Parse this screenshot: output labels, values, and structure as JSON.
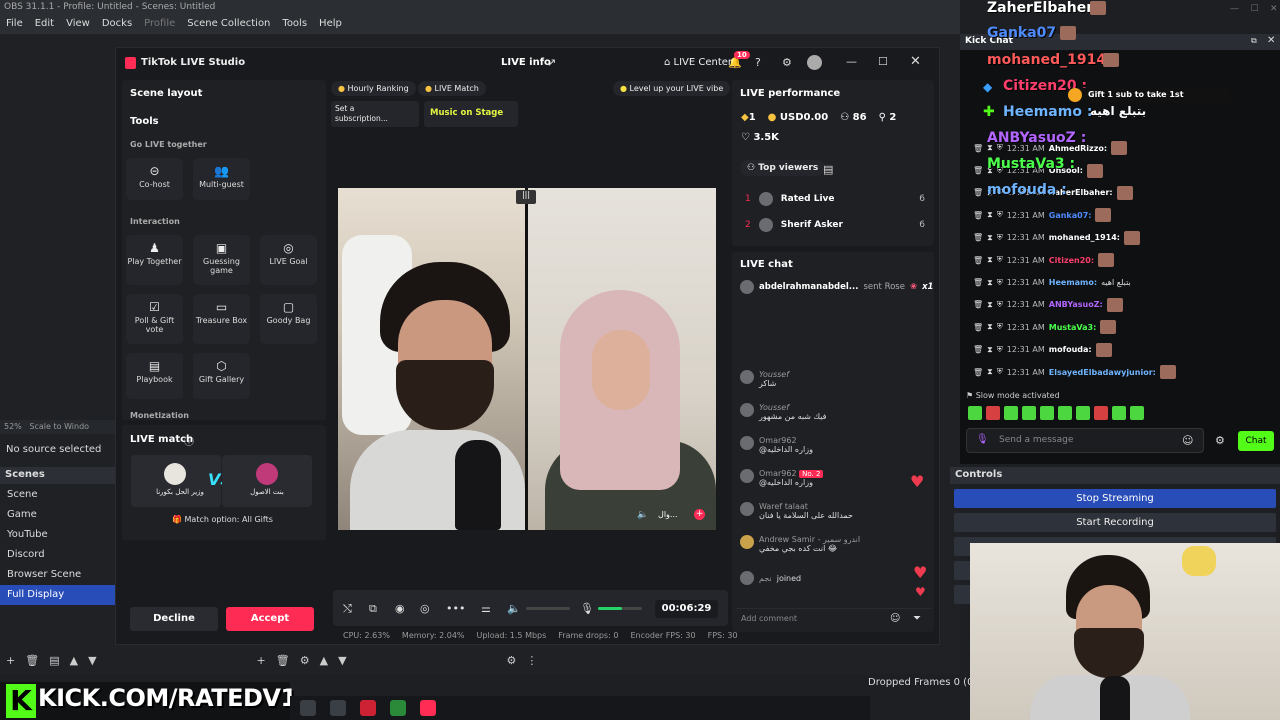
{
  "obs": {
    "title": "OBS 31.1.1 - Profile: Untitled - Scenes: Untitled",
    "menu": [
      "File",
      "Edit",
      "View",
      "Docks",
      "Profile",
      "Scene Collection",
      "Tools",
      "Help"
    ],
    "zoom": "52%",
    "scale_label": "Scale to Windo",
    "no_source": "No source selected",
    "scenes_title": "Scenes",
    "scenes": [
      "Scene",
      "Game",
      "YouTube",
      "Discord",
      "Browser Scene",
      "Full Display"
    ],
    "selected_scene": "Full Display",
    "dropped_frames": "Dropped Frames 0 (0.0%)",
    "kick_url": "KICK.COM/RATEDV1",
    "kick_k": "K"
  },
  "tiktok": {
    "app_name": "TikTok LIVE Studio",
    "live_info": "LIVE info",
    "live_center": "LIVE Center",
    "notif_count": "10",
    "scene_layout": "Scene layout",
    "tools": "Tools",
    "go_live_together": "Go LIVE together",
    "cohost": "Co-host",
    "multiguest": "Multi-guest",
    "interaction": "Interaction",
    "tool_items": [
      "Play Together",
      "Guessing game",
      "LIVE Goal",
      "Poll & Gift vote",
      "Treasure Box",
      "Goody Bag",
      "Playbook",
      "Gift Gallery"
    ],
    "monetization": "Monetization",
    "live_match": "LIVE match",
    "match_left": "وزير الحل بكورنا",
    "match_right": "بنت الاصول",
    "vs": "VS",
    "match_option": "Match option: All Gifts",
    "decline": "Decline",
    "accept": "Accept",
    "hourly_ranking": "Hourly Ranking",
    "live_match_pill": "LIVE Match",
    "level_up": "Level up your LIVE vibe",
    "set_sub": "Set a subscription...",
    "music_on_stage": "Music on Stage",
    "video_label": "وال...",
    "timer": "00:06:29",
    "stats": [
      "CPU: 2.63%",
      "Memory: 2.04%",
      "Upload: 1.5 Mbps",
      "Frame drops: 0",
      "Encoder FPS: 30",
      "FPS: 30"
    ],
    "live_performance": "LIVE performance",
    "perf_diamonds": "1",
    "perf_usd": "USD0.00",
    "perf_viewers": "86",
    "perf_new": "2",
    "perf_likes": "3.5K",
    "top_viewers": "Top viewers",
    "viewers": [
      {
        "rank": "1",
        "name": "Rated Live",
        "count": "6"
      },
      {
        "rank": "2",
        "name": "Sherif Asker",
        "count": "6"
      }
    ],
    "live_chat": "LIVE chat",
    "gift_user": "abdelrahmanabdel...",
    "gift_text": "sent Rose",
    "gift_mult": "x1",
    "chat": [
      {
        "name": "Youssef",
        "text": "شاكر"
      },
      {
        "name": "Youssef",
        "text": "فيك شبه من مشهور"
      },
      {
        "name": "Omar962",
        "text": "@وزاره الداخليه"
      },
      {
        "name": "Omar962",
        "badge": "No. 2",
        "text": "@وزاره الداخليه"
      },
      {
        "name": "Waref talaat",
        "text": "حمدالله على السلامة يا فنان"
      },
      {
        "name": "Andrew Samir - اندرو سمير",
        "text": "انت كده بجي مخفي 😂"
      }
    ],
    "joined_name": "نجم",
    "joined_text": "joined",
    "add_comment": "Add comment"
  },
  "kick": {
    "title": "Kick Chat",
    "overlay_names": [
      {
        "name": "ZaherElbaher :",
        "color": "#ffffff"
      },
      {
        "name": "Ganka07 :",
        "color": "#4f8bff"
      },
      {
        "name": "mohaned_1914 :",
        "color": "#ff5a5a"
      },
      {
        "name": "Citizen20 :",
        "color": "#ff3e6c"
      },
      {
        "name": "Heemamo :",
        "color": "#6fb4ff"
      },
      {
        "name": "ANBYasuoZ :",
        "color": "#b266ff"
      },
      {
        "name": "MustaVa3 :",
        "color": "#4cff4c"
      },
      {
        "name": "mofouda :",
        "color": "#6fb4ff"
      }
    ],
    "gift_line": "Gift 1 sub to take 1st",
    "heemamo_text": "بتبلع اهيه",
    "rows": [
      {
        "time": "12:31 AM",
        "name": "AhmedRizzo:",
        "color": "#ffffff"
      },
      {
        "time": "12:31 AM",
        "name": "Onsool:",
        "color": "#ffffff"
      },
      {
        "time": "12:31 AM",
        "name": "ZaherElbaher:",
        "color": "#ffffff"
      },
      {
        "time": "12:31 AM",
        "name": "Ganka07:",
        "color": "#4f8bff"
      },
      {
        "time": "12:31 AM",
        "name": "mohaned_1914:",
        "color": "#ffffff"
      },
      {
        "time": "12:31 AM",
        "name": "Citizen20:",
        "color": "#ff3e6c"
      },
      {
        "time": "12:31 AM",
        "name": "Heemamo:",
        "color": "#6fb4ff",
        "text": "بتبلع اهيه"
      },
      {
        "time": "12:31 AM",
        "name": "ANBYasuoZ:",
        "color": "#b266ff"
      },
      {
        "time": "12:31 AM",
        "name": "MustaVa3:",
        "color": "#4cff4c"
      },
      {
        "time": "12:31 AM",
        "name": "mofouda:",
        "color": "#ffffff"
      },
      {
        "time": "12:31 AM",
        "name": "ElsayedElbadawyjunior:",
        "color": "#6fb4ff"
      }
    ],
    "slow_mode": "Slow mode activated",
    "send_placeholder": "Send a message",
    "chat_button": "Chat",
    "accent": "#53fc18"
  },
  "controls": {
    "title": "Controls",
    "stop_streaming": "Stop Streaming",
    "start_recording": "Start Recording"
  }
}
